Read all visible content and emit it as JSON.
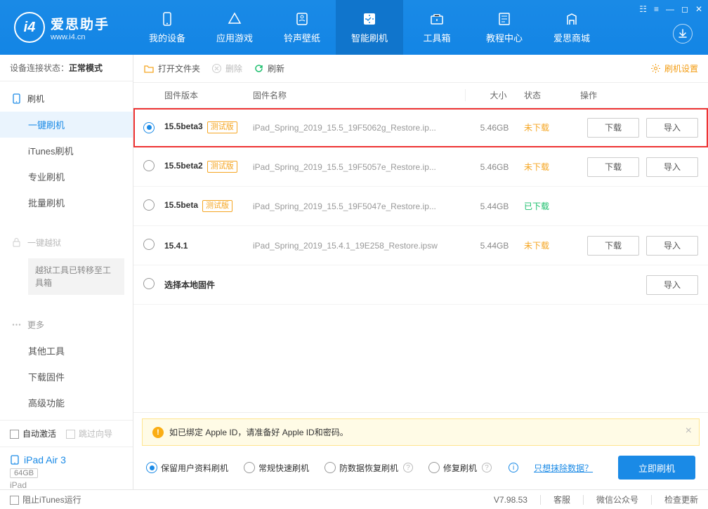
{
  "app": {
    "name": "爱思助手",
    "url": "www.i4.cn"
  },
  "nav": [
    {
      "id": "device",
      "label": "我的设备"
    },
    {
      "id": "apps",
      "label": "应用游戏"
    },
    {
      "id": "ringtone",
      "label": "铃声壁纸"
    },
    {
      "id": "flash",
      "label": "智能刷机"
    },
    {
      "id": "toolbox",
      "label": "工具箱"
    },
    {
      "id": "tutorial",
      "label": "教程中心"
    },
    {
      "id": "store",
      "label": "爱思商城"
    }
  ],
  "nav_active": 3,
  "sidebar": {
    "conn_label": "设备连接状态：",
    "conn_value": "正常模式",
    "flash_head": "刷机",
    "flash_items": [
      "一键刷机",
      "iTunes刷机",
      "专业刷机",
      "批量刷机"
    ],
    "flash_active": 0,
    "jailbreak_head": "一键越狱",
    "jailbreak_note": "越狱工具已转移至工具箱",
    "more_head": "更多",
    "more_items": [
      "其他工具",
      "下载固件",
      "高级功能"
    ],
    "auto_activate": "自动激活",
    "skip_guide": "跳过向导"
  },
  "device": {
    "name": "iPad Air 3",
    "capacity": "64GB",
    "type": "iPad"
  },
  "toolbar": {
    "open": "打开文件夹",
    "delete": "删除",
    "refresh": "刷新",
    "settings": "刷机设置"
  },
  "columns": {
    "version": "固件版本",
    "name": "固件名称",
    "size": "大小",
    "status": "状态",
    "action": "操作"
  },
  "beta_tag": "测试版",
  "firmware": [
    {
      "sel": true,
      "version": "15.5beta3",
      "beta": true,
      "name": "iPad_Spring_2019_15.5_19F5062g_Restore.ip...",
      "size": "5.46GB",
      "status": "未下载",
      "status_cls": "nd",
      "download": true,
      "import": true,
      "hl": true
    },
    {
      "sel": false,
      "version": "15.5beta2",
      "beta": true,
      "name": "iPad_Spring_2019_15.5_19F5057e_Restore.ip...",
      "size": "5.46GB",
      "status": "未下载",
      "status_cls": "nd",
      "download": true,
      "import": true
    },
    {
      "sel": false,
      "version": "15.5beta",
      "beta": true,
      "name": "iPad_Spring_2019_15.5_19F5047e_Restore.ip...",
      "size": "5.44GB",
      "status": "已下载",
      "status_cls": "dl",
      "download": false,
      "import": false
    },
    {
      "sel": false,
      "version": "15.4.1",
      "beta": false,
      "name": "iPad_Spring_2019_15.4.1_19E258_Restore.ipsw",
      "size": "5.44GB",
      "status": "未下载",
      "status_cls": "nd",
      "download": true,
      "import": true
    },
    {
      "sel": false,
      "version": "选择本地固件",
      "beta": false,
      "name": "",
      "size": "",
      "status": "",
      "status_cls": "",
      "download": false,
      "import": true
    }
  ],
  "btn_download": "下载",
  "btn_import": "导入",
  "warning": "如已绑定 Apple ID，请准备好 Apple ID和密码。",
  "modes": [
    {
      "label": "保留用户资料刷机",
      "sel": true,
      "help": false
    },
    {
      "label": "常规快速刷机",
      "sel": false,
      "help": false
    },
    {
      "label": "防数据恢复刷机",
      "sel": false,
      "help": true
    },
    {
      "label": "修复刷机",
      "sel": false,
      "help": true
    }
  ],
  "erase_link": "只想抹除数据？",
  "flash_btn": "立即刷机",
  "status": {
    "block_itunes": "阻止iTunes运行",
    "version": "V7.98.53",
    "support": "客服",
    "wechat": "微信公众号",
    "update": "检查更新"
  }
}
